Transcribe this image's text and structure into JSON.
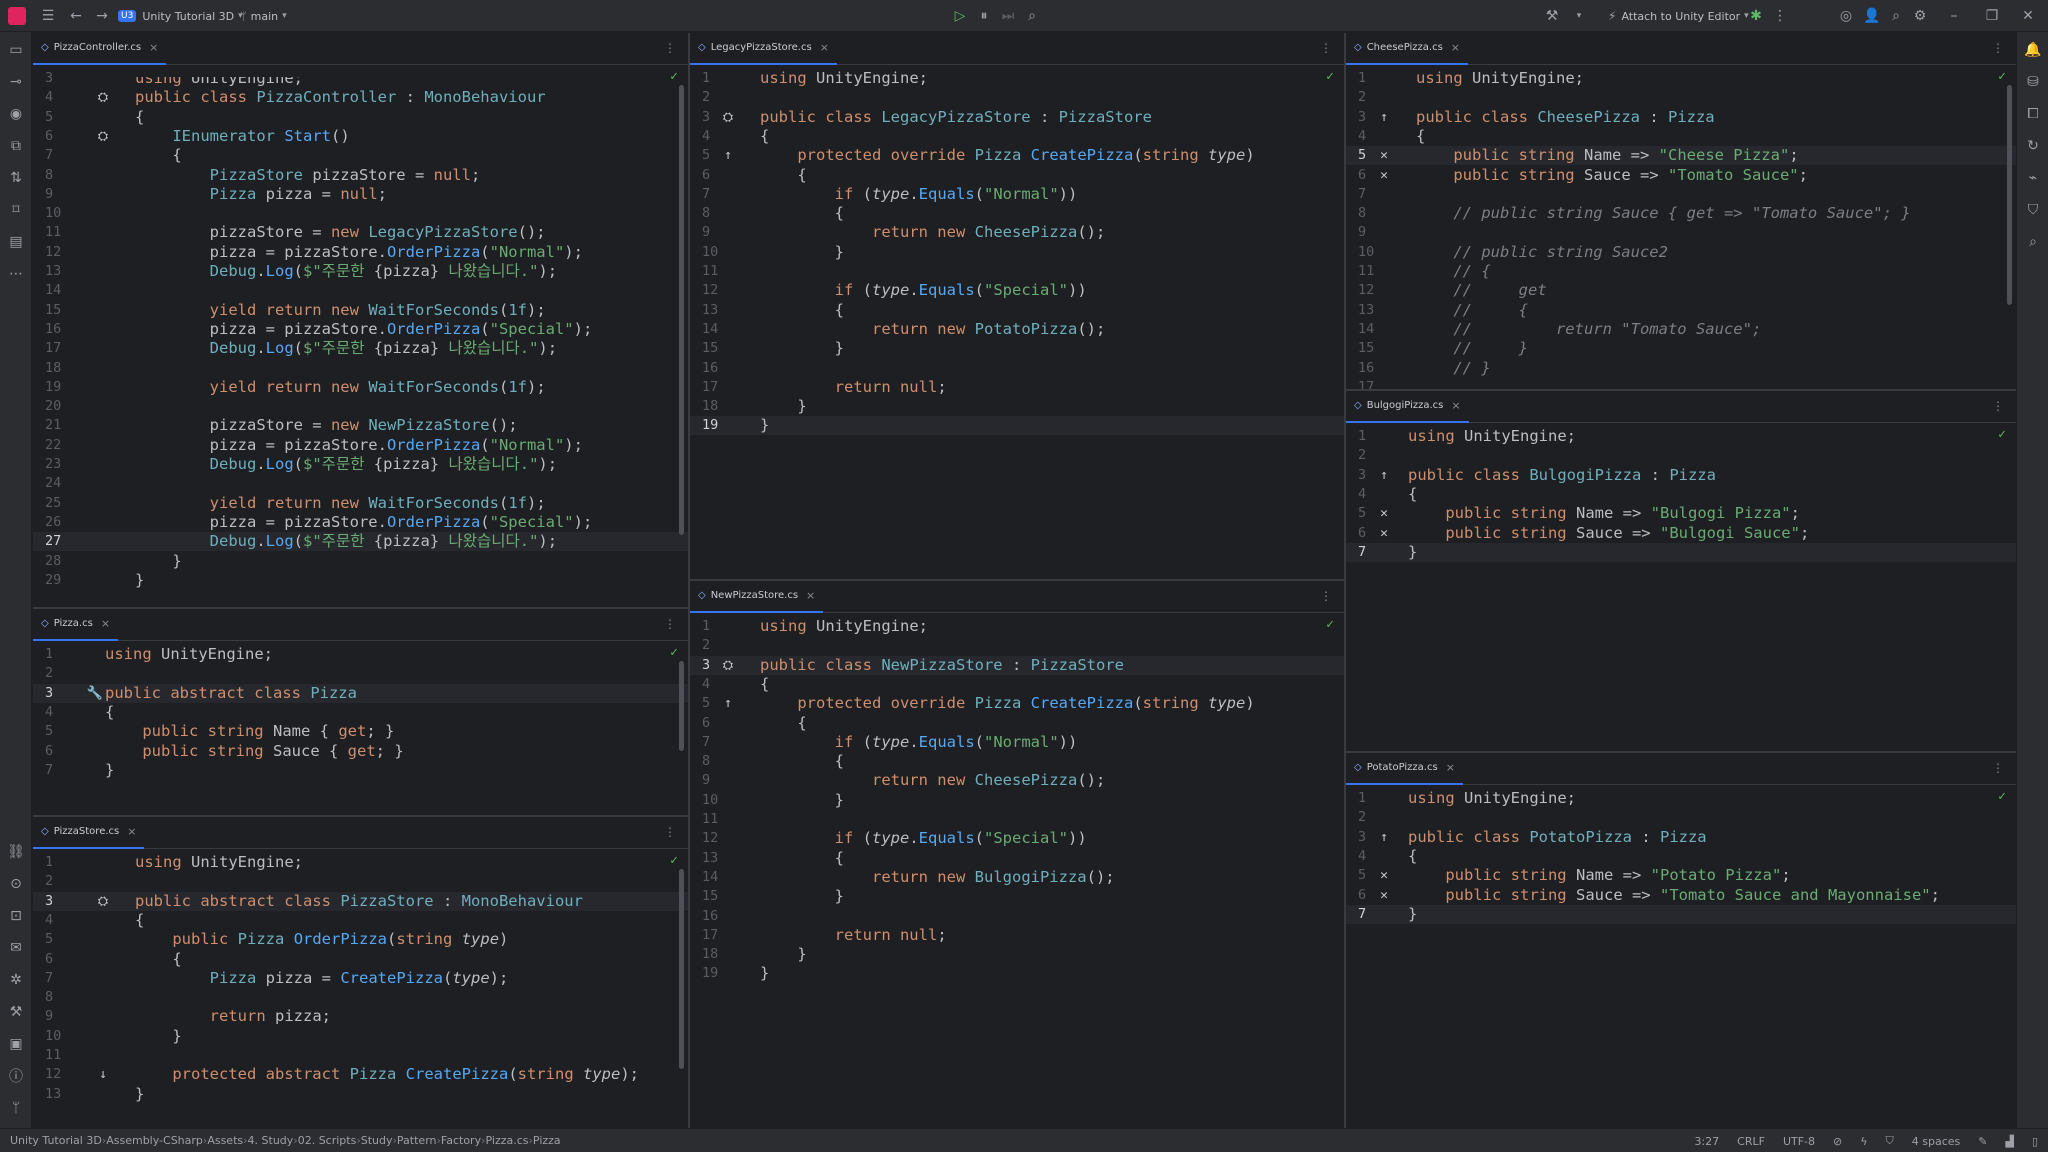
{
  "titlebar": {
    "project_badge": "U3",
    "project_name": "Unity Tutorial 3D",
    "branch": "main",
    "attach_label": "Attach to Unity Editor"
  },
  "panes": [
    {
      "id": "pizza-controller",
      "tab": "PizzaController.cs",
      "current_line": 27,
      "lines": [
        {
          "n": 3,
          "html": "<span class='k'>using</span> UnityEngine;",
          "partial": true
        },
        {
          "n": 4,
          "gut": "⛭",
          "html": "<span class='k'>public class</span> <span class='t'>PizzaController</span> : <span class='t'>MonoBehaviour</span>"
        },
        {
          "n": 5,
          "html": "{"
        },
        {
          "n": 6,
          "gut": "⛭",
          "html": "    <span class='t'>IEnumerator</span> <span class='m'>Start</span>()"
        },
        {
          "n": 7,
          "html": "    {"
        },
        {
          "n": 8,
          "html": "        <span class='t'>PizzaStore</span> pizzaStore = <span class='k'>null</span>;"
        },
        {
          "n": 9,
          "html": "        <span class='t'>Pizza</span> pizza = <span class='k'>null</span>;"
        },
        {
          "n": 10,
          "html": ""
        },
        {
          "n": 11,
          "html": "        pizzaStore = <span class='k'>new</span> <span class='t'>LegacyPizzaStore</span>();"
        },
        {
          "n": 12,
          "html": "        pizza = pizzaStore.<span class='m'>OrderPizza</span>(<span class='s'>\"Normal\"</span>);"
        },
        {
          "n": 13,
          "html": "        <span class='t'>Debug</span>.<span class='m'>Log</span>(<span class='s'>$\"주문한 </span>{pizza}<span class='s'> 나왔습니다.\"</span>);"
        },
        {
          "n": 14,
          "html": ""
        },
        {
          "n": 15,
          "html": "        <span class='k'>yield return new</span> <span class='t'>WaitForSeconds</span>(<span class='t'>1f</span>);"
        },
        {
          "n": 16,
          "html": "        pizza = pizzaStore.<span class='m'>OrderPizza</span>(<span class='s'>\"Special\"</span>);"
        },
        {
          "n": 17,
          "html": "        <span class='t'>Debug</span>.<span class='m'>Log</span>(<span class='s'>$\"주문한 </span>{pizza}<span class='s'> 나왔습니다.\"</span>);"
        },
        {
          "n": 18,
          "html": ""
        },
        {
          "n": 19,
          "html": "        <span class='k'>yield return new</span> <span class='t'>WaitForSeconds</span>(<span class='t'>1f</span>);"
        },
        {
          "n": 20,
          "html": ""
        },
        {
          "n": 21,
          "html": "        pizzaStore = <span class='k'>new</span> <span class='t'>NewPizzaStore</span>();"
        },
        {
          "n": 22,
          "html": "        pizza = pizzaStore.<span class='m'>OrderPizza</span>(<span class='s'>\"Normal\"</span>);"
        },
        {
          "n": 23,
          "html": "        <span class='t'>Debug</span>.<span class='m'>Log</span>(<span class='s'>$\"주문한 </span>{pizza}<span class='s'> 나왔습니다.\"</span>);"
        },
        {
          "n": 24,
          "html": ""
        },
        {
          "n": 25,
          "html": "        <span class='k'>yield return new</span> <span class='t'>WaitForSeconds</span>(<span class='t'>1f</span>);"
        },
        {
          "n": 26,
          "html": "        pizza = pizzaStore.<span class='m'>OrderPizza</span>(<span class='s'>\"Special\"</span>);"
        },
        {
          "n": 27,
          "html": "        <span class='t'>Debug</span>.<span class='m'>Log</span>(<span class='s'>$\"주문한 </span>{pizza}<span class='s'> 나왔습니다.\"</span>);"
        },
        {
          "n": 28,
          "html": "    }"
        },
        {
          "n": 29,
          "html": "}"
        }
      ]
    },
    {
      "id": "pizza",
      "tab": "Pizza.cs",
      "current_line": 3,
      "lines": [
        {
          "n": 1,
          "html": "<span class='k'>using</span> UnityEngine;"
        },
        {
          "n": 2,
          "html": ""
        },
        {
          "n": 3,
          "gut": "🔧",
          "html": "<span class='k'>public abstract class</span> <span class='t'>Pizza</span>"
        },
        {
          "n": 4,
          "html": "{"
        },
        {
          "n": 5,
          "html": "    <span class='k'>public string</span> Name { <span class='k'>get</span>; }"
        },
        {
          "n": 6,
          "html": "    <span class='k'>public string</span> Sauce { <span class='k'>get</span>; }"
        },
        {
          "n": 7,
          "html": "}"
        }
      ]
    },
    {
      "id": "pizza-store",
      "tab": "PizzaStore.cs",
      "current_line": 3,
      "lines": [
        {
          "n": 1,
          "html": "<span class='k'>using</span> UnityEngine;"
        },
        {
          "n": 2,
          "html": ""
        },
        {
          "n": 3,
          "gut": "⛭",
          "html": "<span class='k'>public abstract class</span> <span class='t'>PizzaStore</span> : <span class='t'>MonoBehaviour</span>"
        },
        {
          "n": 4,
          "html": "{"
        },
        {
          "n": 5,
          "html": "    <span class='k'>public</span> <span class='t'>Pizza</span> <span class='m'>OrderPizza</span>(<span class='k'>string</span> <span class='p'>type</span>)"
        },
        {
          "n": 6,
          "html": "    {"
        },
        {
          "n": 7,
          "html": "        <span class='t'>Pizza</span> pizza = <span class='m'>CreatePizza</span>(<span class='p'>type</span>);"
        },
        {
          "n": 8,
          "html": ""
        },
        {
          "n": 9,
          "html": "        <span class='k'>return</span> pizza;"
        },
        {
          "n": 10,
          "html": "    }"
        },
        {
          "n": 11,
          "html": ""
        },
        {
          "n": 12,
          "gut": "↓",
          "html": "    <span class='k'>protected abstract</span> <span class='t'>Pizza</span> <span class='m'>CreatePizza</span>(<span class='k'>string</span> <span class='p'>type</span>);"
        },
        {
          "n": 13,
          "html": "}"
        }
      ]
    },
    {
      "id": "legacy-pizza-store",
      "tab": "LegacyPizzaStore.cs",
      "current_line": 19,
      "lines": [
        {
          "n": 1,
          "html": "<span class='k'>using</span> UnityEngine;"
        },
        {
          "n": 2,
          "html": ""
        },
        {
          "n": 3,
          "gut": "⛭",
          "html": "<span class='k'>public class</span> <span class='t'>LegacyPizzaStore</span> : <span class='t'>PizzaStore</span>"
        },
        {
          "n": 4,
          "html": "{"
        },
        {
          "n": 5,
          "gut": "↑",
          "html": "    <span class='k'>protected override</span> <span class='t'>Pizza</span> <span class='m'>CreatePizza</span>(<span class='k'>string</span> <span class='p'>type</span>)"
        },
        {
          "n": 6,
          "html": "    {"
        },
        {
          "n": 7,
          "html": "        <span class='k'>if</span> (<span class='p'>type</span>.<span class='m'>Equals</span>(<span class='s'>\"Normal\"</span>))"
        },
        {
          "n": 8,
          "html": "        {"
        },
        {
          "n": 9,
          "html": "            <span class='k'>return new</span> <span class='t'>CheesePizza</span>();"
        },
        {
          "n": 10,
          "html": "        }"
        },
        {
          "n": 11,
          "html": ""
        },
        {
          "n": 12,
          "html": "        <span class='k'>if</span> (<span class='p'>type</span>.<span class='m'>Equals</span>(<span class='s'>\"Special\"</span>))"
        },
        {
          "n": 13,
          "html": "        {"
        },
        {
          "n": 14,
          "html": "            <span class='k'>return new</span> <span class='t'>PotatoPizza</span>();"
        },
        {
          "n": 15,
          "html": "        }"
        },
        {
          "n": 16,
          "html": ""
        },
        {
          "n": 17,
          "html": "        <span class='k'>return null</span>;"
        },
        {
          "n": 18,
          "html": "    }"
        },
        {
          "n": 19,
          "html": "}"
        }
      ]
    },
    {
      "id": "new-pizza-store",
      "tab": "NewPizzaStore.cs",
      "current_line": 3,
      "lines": [
        {
          "n": 1,
          "html": "<span class='k'>using</span> UnityEngine;"
        },
        {
          "n": 2,
          "html": ""
        },
        {
          "n": 3,
          "gut": "⛭",
          "html": "<span class='k'>public class</span> <span class='t'>NewPizzaStore</span> : <span class='t'>PizzaStore</span>"
        },
        {
          "n": 4,
          "html": "{"
        },
        {
          "n": 5,
          "gut": "↑",
          "html": "    <span class='k'>protected override</span> <span class='t'>Pizza</span> <span class='m'>CreatePizza</span>(<span class='k'>string</span> <span class='p'>type</span>)"
        },
        {
          "n": 6,
          "html": "    {"
        },
        {
          "n": 7,
          "html": "        <span class='k'>if</span> (<span class='p'>type</span>.<span class='m'>Equals</span>(<span class='s'>\"Normal\"</span>))"
        },
        {
          "n": 8,
          "html": "        {"
        },
        {
          "n": 9,
          "html": "            <span class='k'>return new</span> <span class='t'>CheesePizza</span>();"
        },
        {
          "n": 10,
          "html": "        }"
        },
        {
          "n": 11,
          "html": ""
        },
        {
          "n": 12,
          "html": "        <span class='k'>if</span> (<span class='p'>type</span>.<span class='m'>Equals</span>(<span class='s'>\"Special\"</span>))"
        },
        {
          "n": 13,
          "html": "        {"
        },
        {
          "n": 14,
          "html": "            <span class='k'>return new</span> <span class='t'>BulgogiPizza</span>();"
        },
        {
          "n": 15,
          "html": "        }"
        },
        {
          "n": 16,
          "html": ""
        },
        {
          "n": 17,
          "html": "        <span class='k'>return null</span>;"
        },
        {
          "n": 18,
          "html": "    }"
        },
        {
          "n": 19,
          "html": "}"
        }
      ]
    },
    {
      "id": "cheese-pizza",
      "tab": "CheesePizza.cs",
      "current_line": 5,
      "lines": [
        {
          "n": 1,
          "html": "<span class='k'>using</span> UnityEngine;"
        },
        {
          "n": 2,
          "html": ""
        },
        {
          "n": 3,
          "gut": "↑",
          "html": "<span class='k'>public class</span> <span class='t'>CheesePizza</span> : <span class='t'>Pizza</span>"
        },
        {
          "n": 4,
          "html": "{"
        },
        {
          "n": 5,
          "gut": "✕",
          "html": "    <span class='k'>public string</span> Name => <span class='s'>\"Cheese Pizza\"</span>;"
        },
        {
          "n": 6,
          "gut": "✕",
          "html": "    <span class='k'>public string</span> Sauce => <span class='s'>\"Tomato Sauce\"</span>;"
        },
        {
          "n": 7,
          "html": ""
        },
        {
          "n": 8,
          "html": "    <span class='c'>// public string Sauce { get => \"Tomato Sauce\"; }</span>"
        },
        {
          "n": 9,
          "html": ""
        },
        {
          "n": 10,
          "html": "    <span class='c'>// public string Sauce2</span>"
        },
        {
          "n": 11,
          "html": "    <span class='c'>// {</span>"
        },
        {
          "n": 12,
          "html": "    <span class='c'>//     get</span>"
        },
        {
          "n": 13,
          "html": "    <span class='c'>//     {</span>"
        },
        {
          "n": 14,
          "html": "    <span class='c'>//         return \"Tomato Sauce\";</span>"
        },
        {
          "n": 15,
          "html": "    <span class='c'>//     }</span>"
        },
        {
          "n": 16,
          "html": "    <span class='c'>// }</span>"
        },
        {
          "n": 17,
          "html": ""
        }
      ]
    },
    {
      "id": "bulgogi-pizza",
      "tab": "BulgogiPizza.cs",
      "current_line": 7,
      "lines": [
        {
          "n": 1,
          "html": "<span class='k'>using</span> UnityEngine;"
        },
        {
          "n": 2,
          "html": ""
        },
        {
          "n": 3,
          "gut": "↑",
          "html": "<span class='k'>public class</span> <span class='t'>BulgogiPizza</span> : <span class='t'>Pizza</span>"
        },
        {
          "n": 4,
          "html": "{"
        },
        {
          "n": 5,
          "gut": "✕",
          "html": "    <span class='k'>public string</span> Name => <span class='s'>\"Bulgogi Pizza\"</span>;"
        },
        {
          "n": 6,
          "gut": "✕",
          "html": "    <span class='k'>public string</span> Sauce => <span class='s'>\"Bulgogi Sauce\"</span>;"
        },
        {
          "n": 7,
          "html": "}"
        }
      ]
    },
    {
      "id": "potato-pizza",
      "tab": "PotatoPizza.cs",
      "current_line": 7,
      "lines": [
        {
          "n": 1,
          "html": "<span class='k'>using</span> UnityEngine;"
        },
        {
          "n": 2,
          "html": ""
        },
        {
          "n": 3,
          "gut": "↑",
          "html": "<span class='k'>public class</span> <span class='t'>PotatoPizza</span> : <span class='t'>Pizza</span>"
        },
        {
          "n": 4,
          "html": "{"
        },
        {
          "n": 5,
          "gut": "✕",
          "html": "    <span class='k'>public string</span> Name => <span class='s'>\"Potato Pizza\"</span>;"
        },
        {
          "n": 6,
          "gut": "✕",
          "html": "    <span class='k'>public string</span> Sauce => <span class='s'>\"Tomato Sauce and Mayonnaise\"</span>;"
        },
        {
          "n": 7,
          "html": "}"
        }
      ]
    }
  ],
  "statusbar": {
    "breadcrumbs": [
      "Unity Tutorial 3D",
      "Assembly-CSharp",
      "Assets",
      "4. Study",
      "02. Scripts",
      "Study",
      "Pattern",
      "Factory",
      "Pizza.cs",
      "Pizza"
    ],
    "cursor": "3:27",
    "line_ending": "CRLF",
    "encoding": "UTF-8",
    "indent": "4 spaces"
  },
  "colors": {
    "accent": "#3574f0",
    "keyword": "#cf8e6d",
    "type": "#6fafbd",
    "method": "#56a8f5",
    "string": "#6aab73",
    "comment": "#7a7e85"
  }
}
